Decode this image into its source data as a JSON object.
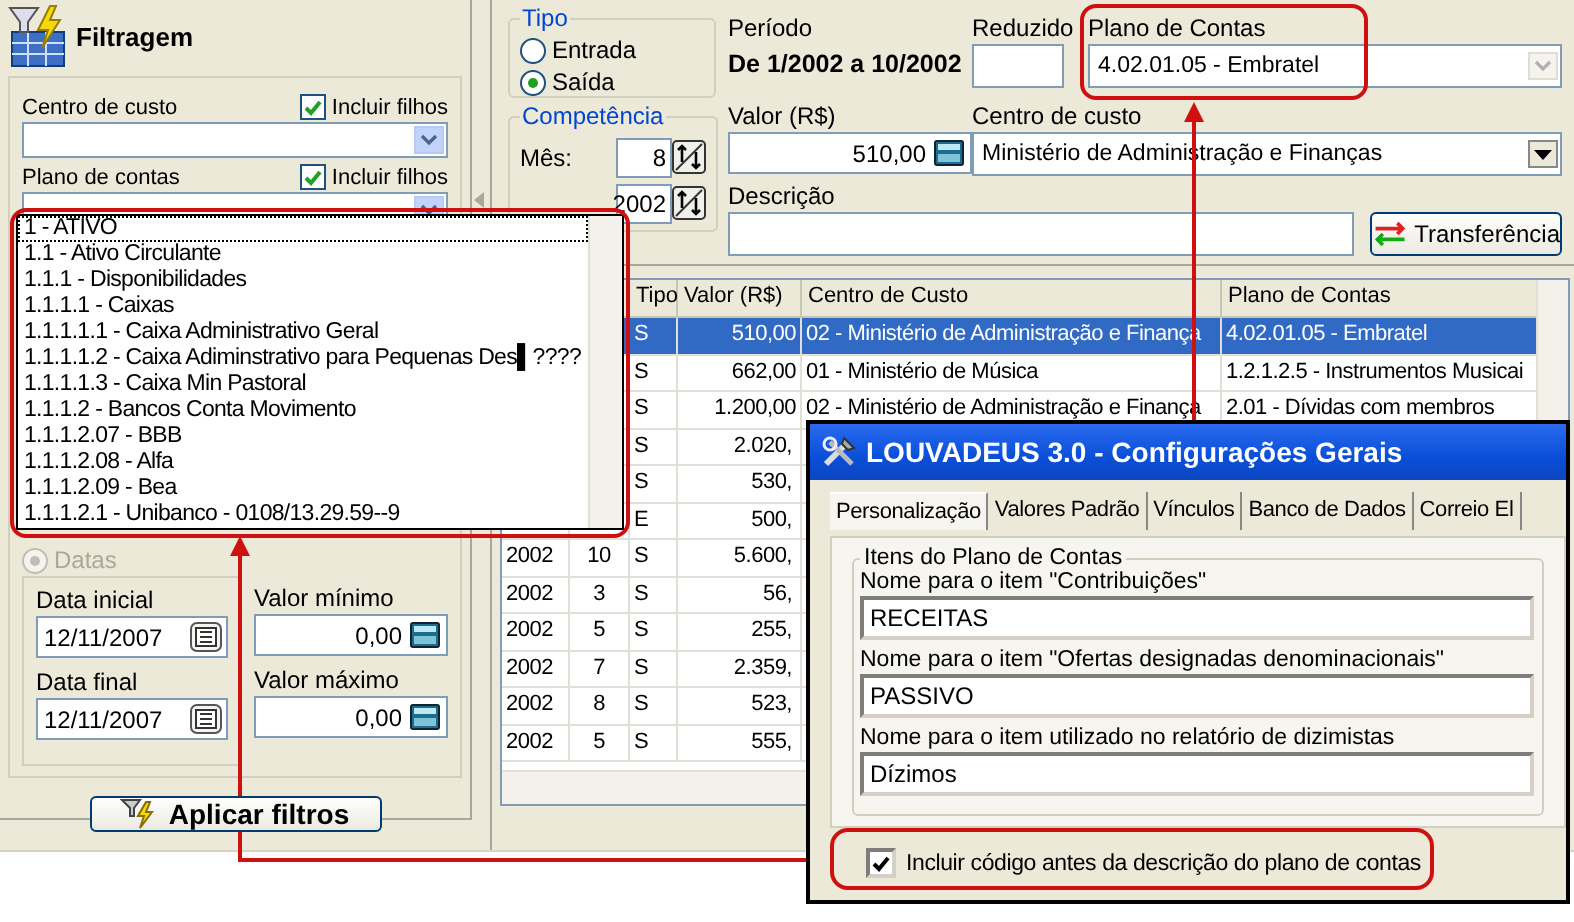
{
  "filter_panel": {
    "title": "Filtragem",
    "cost_center": {
      "label": "Centro de custo",
      "include_children": {
        "label": "Incluir filhos",
        "checked": true
      }
    },
    "account_plan": {
      "label": "Plano de contas",
      "include_children": {
        "label": "Incluir filhos",
        "checked": true
      }
    },
    "dates_option": {
      "label": "Datas",
      "selected": true,
      "disabled": true
    },
    "start_date": {
      "label": "Data inicial",
      "value": "12/11/2007"
    },
    "end_date": {
      "label": "Data final",
      "value": "12/11/2007"
    },
    "min_value": {
      "label": "Valor mínimo",
      "value": "0,00"
    },
    "max_value": {
      "label": "Valor máximo",
      "value": "0,00"
    },
    "apply_button": "Aplicar filtros"
  },
  "entry_form": {
    "type_group": {
      "label": "Tipo",
      "options": [
        {
          "label": "Entrada",
          "selected": false
        },
        {
          "label": "Saída",
          "selected": true
        }
      ]
    },
    "competence_group": {
      "label": "Competência",
      "month": {
        "label": "Mês:",
        "value": "8"
      },
      "year": {
        "value": "2002"
      }
    },
    "period": {
      "label": "Período",
      "value": "De 1/2002 a 10/2002"
    },
    "reduced": {
      "label": "Reduzido"
    },
    "account_plan": {
      "label": "Plano de Contas",
      "value": "4.02.01.05 - Embratel",
      "disabled": true
    },
    "amount": {
      "label": "Valor (R$)",
      "value": "510,00"
    },
    "cost_center": {
      "label": "Centro de custo",
      "value": "Ministério de Administração e Finanças"
    },
    "description": {
      "label": "Descrição"
    },
    "transfer_button": "Transferência"
  },
  "table": {
    "columns": [
      "Tipo",
      "Valor (R$)",
      "Centro de Custo",
      "Plano de Contas"
    ],
    "rows": [
      {
        "type": "S",
        "value": "510,00",
        "cost_center": "02 - Ministério de Administração e Finança",
        "account": "4.02.01.05 - Embratel",
        "selected": true
      },
      {
        "type": "S",
        "value": "662,00",
        "cost_center": "01 - Ministério de Música",
        "account": "1.2.1.2.5 - Instrumentos Musicai",
        "selected": false
      },
      {
        "type": "S",
        "value": "1.200,00",
        "cost_center": "02 - Ministério de Administração e Finança",
        "account": "2.01 - Dívidas com membros",
        "selected": false
      },
      {
        "type": "S",
        "value": "2.020,",
        "selected": false
      },
      {
        "type": "S",
        "value": "530,",
        "selected": false
      },
      {
        "type": "E",
        "value": "500,",
        "selected": false
      },
      {
        "year": "2002",
        "month": "10",
        "type": "S",
        "value": "5.600,",
        "selected": false
      },
      {
        "year": "2002",
        "month": "3",
        "type": "S",
        "value": "56,",
        "selected": false
      },
      {
        "year": "2002",
        "month": "5",
        "type": "S",
        "value": "255,",
        "selected": false
      },
      {
        "year": "2002",
        "month": "7",
        "type": "S",
        "value": "2.359,",
        "selected": false
      },
      {
        "year": "2002",
        "month": "8",
        "type": "S",
        "value": "523,",
        "selected": false
      },
      {
        "year": "2002",
        "month": "5",
        "type": "S",
        "value": "555,",
        "selected": false
      }
    ]
  },
  "account_dropdown": {
    "items": [
      {
        "label": "1 - ATIVO",
        "selected": true
      },
      {
        "label": "1.1 - Ativo Circulante",
        "selected": false
      },
      {
        "label": "1.1.1 - Disponibilidades",
        "selected": false
      },
      {
        "label": "1.1.1.1 - Caixas",
        "selected": false
      },
      {
        "label": "1.1.1.1.1 - Caixa Administrativo Geral",
        "selected": false
      },
      {
        "label": "1.1.1.1.2 - Caixa Adiminstrativo para Pequenas Des▌????",
        "selected": false
      },
      {
        "label": "1.1.1.1.3 - Caixa Min Pastoral",
        "selected": false
      },
      {
        "label": "1.1.1.2 - Bancos Conta Movimento",
        "selected": false
      },
      {
        "label": "1.1.1.2.07 - BBB",
        "selected": false
      },
      {
        "label": "1.1.1.2.08 - Alfa",
        "selected": false
      },
      {
        "label": "1.1.1.2.09 - Bea",
        "selected": false
      },
      {
        "label": "1.1.1.2.1 - Unibanco - 0108/13.29.59--9",
        "selected": false
      }
    ]
  },
  "settings_dialog": {
    "title": "LOUVADEUS 3.0 - Configurações Gerais",
    "tabs": [
      {
        "label": "Personalização",
        "selected": true
      },
      {
        "label": "Valores Padrão",
        "selected": false
      },
      {
        "label": "Vínculos",
        "selected": false
      },
      {
        "label": "Banco de Dados",
        "selected": false
      },
      {
        "label": "Correio El",
        "selected": false
      }
    ],
    "group": {
      "label": "Itens do Plano de Contas",
      "fields": [
        {
          "label": "Nome para o item \"Contribuições\"",
          "value": "RECEITAS"
        },
        {
          "label": "Nome para o item \"Ofertas designadas denominacionais\"",
          "value": "PASSIVO"
        },
        {
          "label": "Nome para o item utilizado no relatório de dizimistas",
          "value": "Dízimos"
        }
      ]
    },
    "include_code": {
      "label": "Incluir código antes da descrição do plano de contas",
      "checked": true
    }
  }
}
